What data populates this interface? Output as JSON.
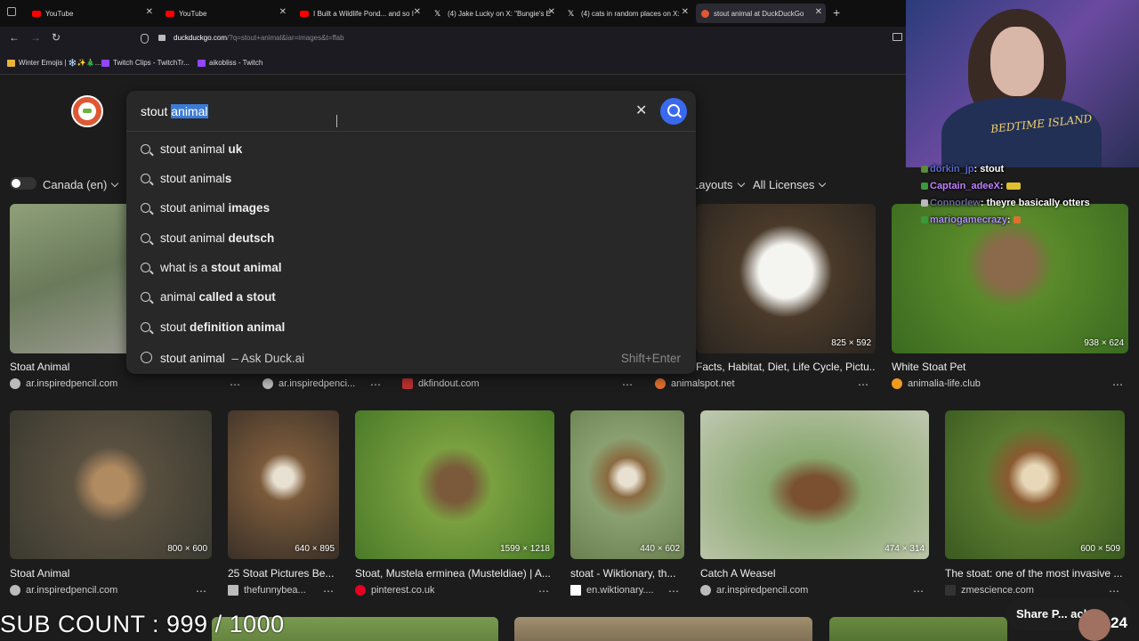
{
  "tabs": [
    {
      "label": "YouTube",
      "icon": "youtube-icon"
    },
    {
      "label": "YouTube",
      "icon": "youtube-icon"
    },
    {
      "label": "I Built a Wildlife Pond... and so I",
      "icon": "youtube-icon"
    },
    {
      "label": "(4) Jake Lucky on X: \"Bungie's E",
      "icon": "x-icon"
    },
    {
      "label": "(4) cats in random places on X:",
      "icon": "x-icon"
    },
    {
      "label": "stout animal at DuckDuckGo",
      "icon": "duckduckgo-icon"
    }
  ],
  "address_bar": {
    "domain": "duckduckgo.com",
    "path": "/?q=stout+animal&iar=images&t=ffab"
  },
  "bookmarks": [
    "Winter Emojis | ❄️✨🎄...",
    "Twitch Clips - TwitchTr...",
    "aikobliss - Twitch"
  ],
  "search": {
    "query_plain": "stout ",
    "query_selected": "animal",
    "suggestions": [
      {
        "pre": "stout animal",
        "bold": " uk"
      },
      {
        "pre": "stout animal",
        "bold": "s"
      },
      {
        "pre": "stout animal",
        "bold": " images"
      },
      {
        "pre": "stout animal",
        "bold": " deutsch"
      },
      {
        "pre": "what is a ",
        "bold": "stout animal"
      },
      {
        "pre": "animal ",
        "bold": "called a stout"
      },
      {
        "pre": "stout ",
        "bold": "definition animal"
      }
    ],
    "ask_ai": {
      "query": "stout animal",
      "label": "– Ask Duck.ai",
      "shortcut": "Shift+Enter"
    }
  },
  "filters": {
    "region": "Canada (en)",
    "layouts": "Layouts",
    "licenses": "All Licenses"
  },
  "row1": [
    {
      "title": "Stoat Animal",
      "source": "ar.inspiredpencil.com"
    },
    {
      "title": "",
      "source": "ar.inspiredpenci..."
    },
    {
      "title": "",
      "source": "dkfindout.com"
    },
    {
      "title": "Facts, Habitat, Diet, Life Cycle, Pictu...",
      "source": "animalspot.net",
      "size": "825 × 592"
    },
    {
      "title": "White Stoat Pet",
      "source": "animalia-life.club",
      "size": "938 × 624"
    }
  ],
  "row2": [
    {
      "title": "Stoat Animal",
      "source": "ar.inspiredpencil.com",
      "size": "800 × 600"
    },
    {
      "title": "25 Stoat Pictures Be...",
      "source": "thefunnybea...",
      "size": "640 × 895"
    },
    {
      "title": "Stoat, Mustela erminea (Musteldiae) | A...",
      "source": "pinterest.co.uk",
      "size": "1599 × 1218"
    },
    {
      "title": "stoat - Wiktionary, th...",
      "source": "en.wiktionary....",
      "size": "440 × 602"
    },
    {
      "title": "Catch A Weasel",
      "source": "ar.inspiredpencil.com",
      "size": "474 × 314"
    },
    {
      "title": "The stoat: one of the most invasive ...",
      "source": "zmescience.com",
      "size": "600 × 509"
    }
  ],
  "overlay": {
    "shirt_text": "BEDTIME ISLAND",
    "chat": [
      {
        "user": "dorkin_jp",
        "msg": "stout"
      },
      {
        "user": "Captain_adeeX",
        "msg": ""
      },
      {
        "user": "Connorlew",
        "msg": "theyre basically otters"
      },
      {
        "user": "mariogamecrazy",
        "msg": ""
      }
    ],
    "sub_count": "SUB COUNT : 999 / 1000",
    "share_label": "Share P... ack",
    "share_number": "24"
  },
  "colors": {
    "accent": "#3969ef",
    "ddg_orange": "#de5833",
    "background": "#1c1c1c"
  }
}
